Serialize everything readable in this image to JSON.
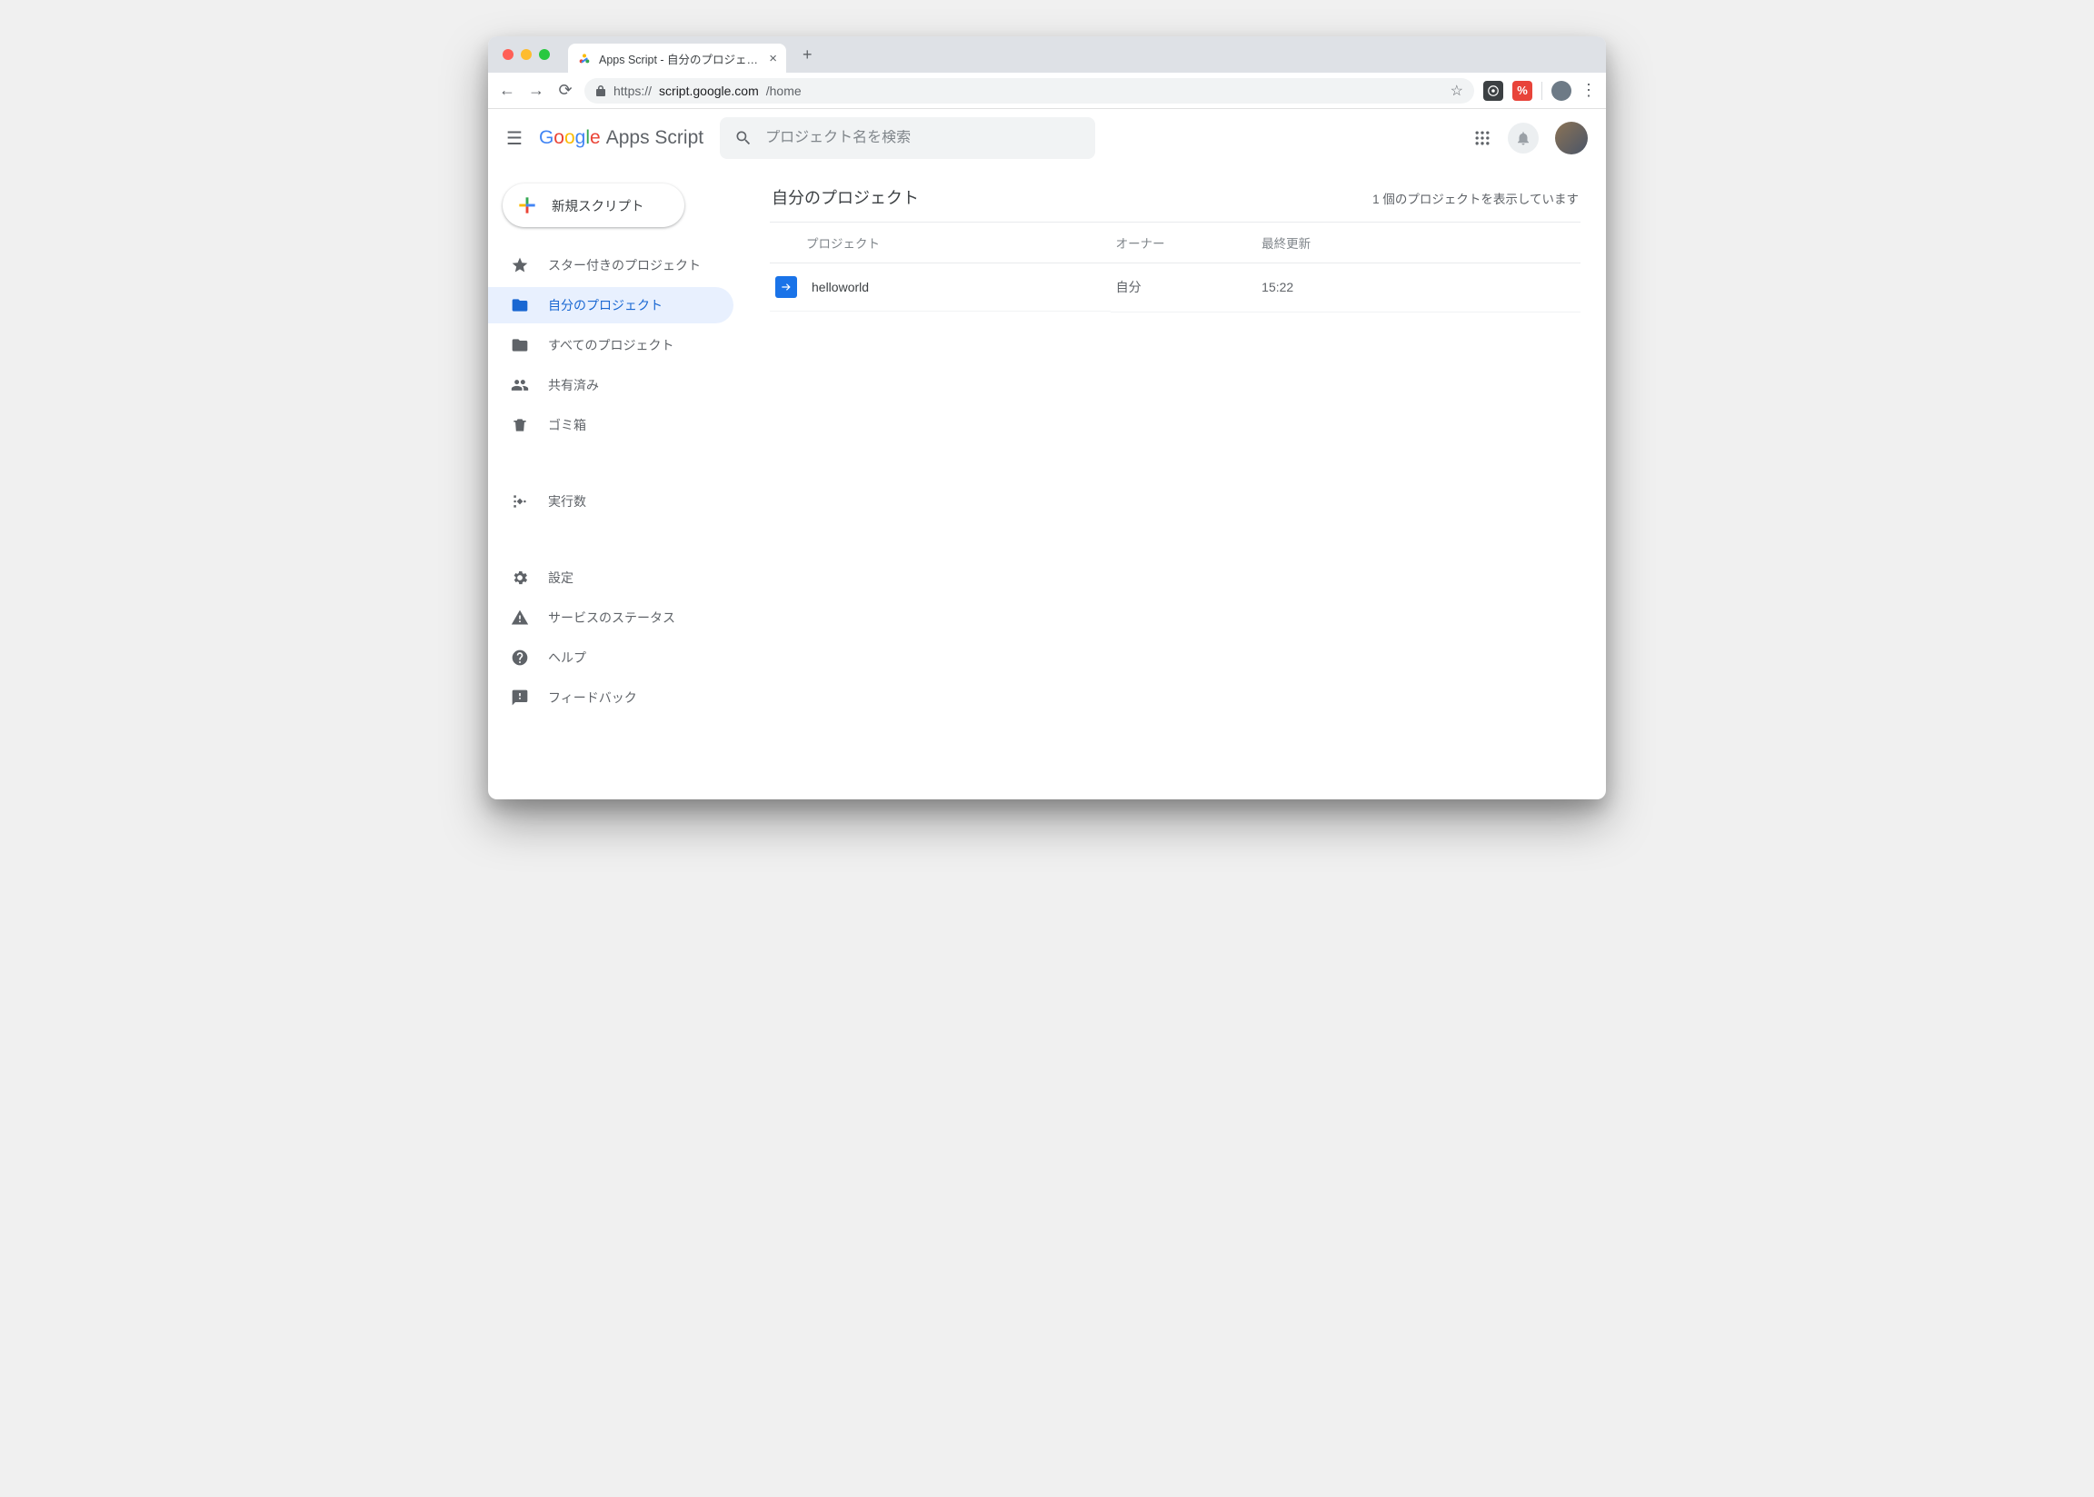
{
  "browser": {
    "tab_title": "Apps Script - 自分のプロジェクト",
    "url_scheme": "https://",
    "url_host": "script.google.com",
    "url_path": "/home"
  },
  "header": {
    "logo_product": "Apps Script",
    "search_placeholder": "プロジェクト名を検索"
  },
  "sidebar": {
    "new_button": "新規スクリプト",
    "items": {
      "starred": "スター付きのプロジェクト",
      "mine": "自分のプロジェクト",
      "all": "すべてのプロジェクト",
      "shared": "共有済み",
      "trash": "ゴミ箱",
      "executions": "実行数",
      "settings": "設定",
      "status": "サービスのステータス",
      "help": "ヘルプ",
      "feedback": "フィードバック"
    }
  },
  "main": {
    "title": "自分のプロジェクト",
    "count_text": "1 個のプロジェクトを表示しています",
    "columns": {
      "project": "プロジェクト",
      "owner": "オーナー",
      "updated": "最終更新"
    },
    "rows": [
      {
        "name": "helloworld",
        "owner": "自分",
        "updated": "15:22"
      }
    ]
  }
}
